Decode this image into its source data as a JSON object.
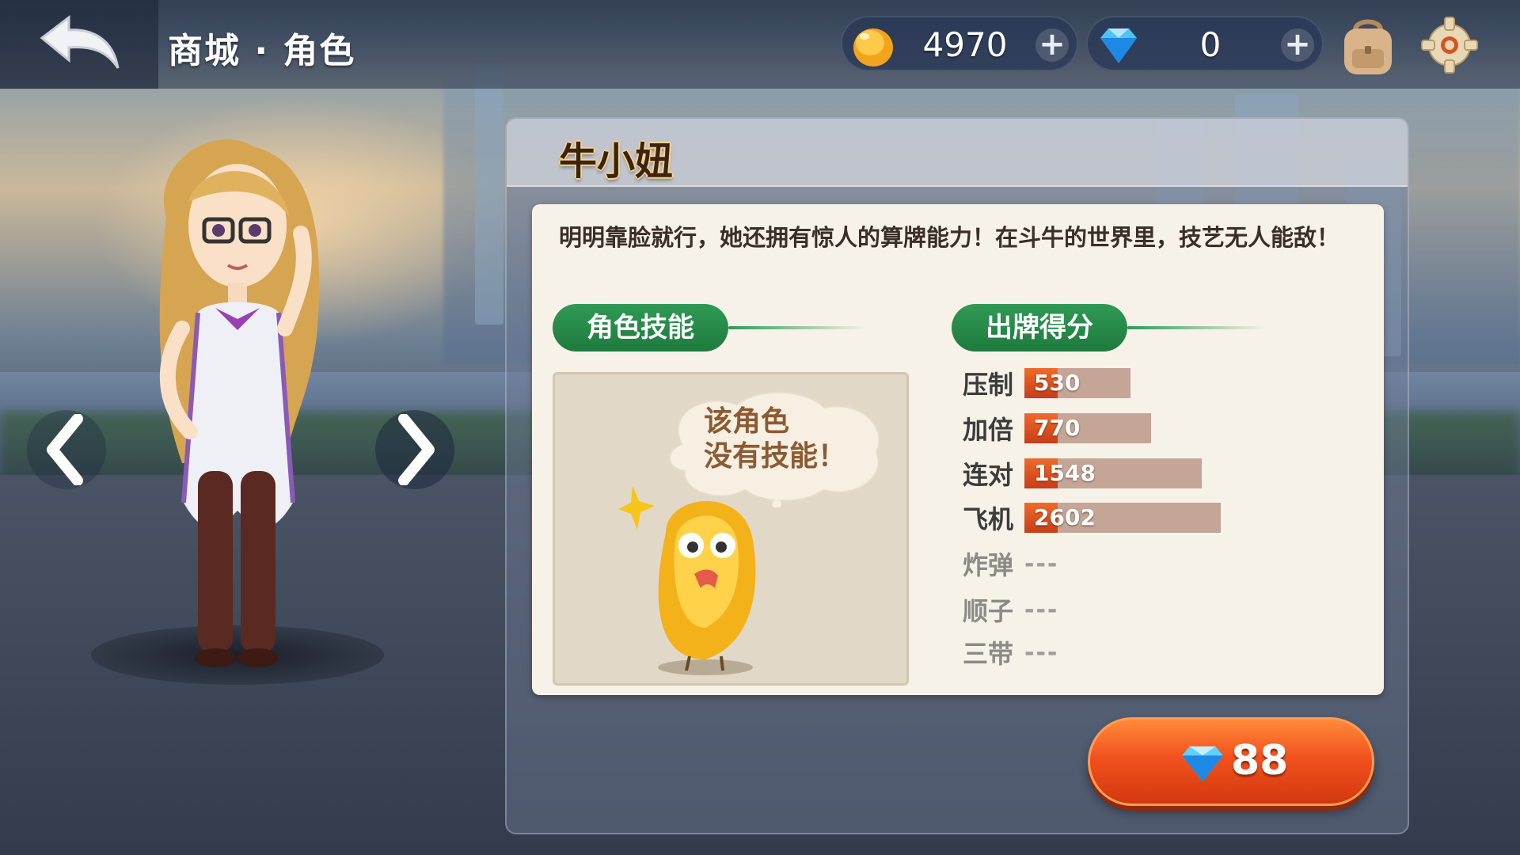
{
  "header": {
    "title": "商城 · 角色",
    "gold": {
      "icon": "gold-bean-icon",
      "value": "4970",
      "plus": "+"
    },
    "diamond": {
      "icon": "diamond-icon",
      "value": "0",
      "plus": "+"
    },
    "icons": {
      "back": "back-arrow-icon",
      "bag": "backpack-icon",
      "settings": "gear-icon"
    }
  },
  "character": {
    "name": "牛小妞",
    "description": "明明靠脸就行，她还拥有惊人的算牌能力！在斗牛的世界里，技艺无人能敌！"
  },
  "skill": {
    "tab_label": "角色技能",
    "bubble_text_line1": "该角色",
    "bubble_text_line2": "没有技能！"
  },
  "score": {
    "tab_label": "出牌得分",
    "rows": [
      {
        "label": "压制",
        "value": "530",
        "fill": 0.2
      },
      {
        "label": "加倍",
        "value": "770",
        "fill": 0.3
      },
      {
        "label": "连对",
        "value": "1548",
        "fill": 0.6
      },
      {
        "label": "飞机",
        "value": "2602",
        "fill": 1.0
      },
      {
        "label": "炸弹",
        "value": "---"
      },
      {
        "label": "顺子",
        "value": "---"
      },
      {
        "label": "三带",
        "value": "---"
      }
    ]
  },
  "purchase": {
    "price": "88",
    "icon": "diamond-icon"
  },
  "colors": {
    "accent_green": "#2f9a54",
    "buy_orange": "#f2521d",
    "bar_red": "#e2522a",
    "bar_bg": "#c4a596"
  }
}
